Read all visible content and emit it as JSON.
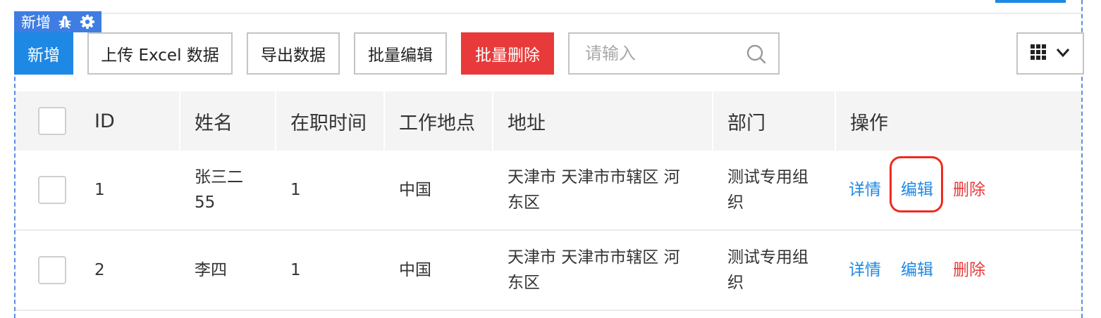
{
  "designer_tag": {
    "label": "新增",
    "icons": [
      "bug-icon",
      "gear-icon"
    ]
  },
  "toolbar": {
    "add_label": "新增",
    "upload_label": "上传 Excel 数据",
    "export_label": "导出数据",
    "batch_edit_label": "批量编辑",
    "batch_delete_label": "批量删除",
    "search_placeholder": "请输入",
    "column_toggle_icons": [
      "grid-icon",
      "chevron-down-icon"
    ]
  },
  "table": {
    "columns": [
      "ID",
      "姓名",
      "在职时间",
      "工作地点",
      "地址",
      "部门",
      "操作"
    ],
    "rows": [
      {
        "id": "1",
        "name_line1": "张三二",
        "name_line2": "55",
        "tenure": "1",
        "location": "中国",
        "address_line1": "天津市 天津市市辖区 河",
        "address_line2": "东区",
        "dept_line1": "测试专用组",
        "dept_line2": "织",
        "actions": {
          "detail": "详情",
          "edit": "编辑",
          "delete": "删除"
        }
      },
      {
        "id": "2",
        "name_line1": "李四",
        "name_line2": "",
        "tenure": "1",
        "location": "中国",
        "address_line1": "天津市 天津市市辖区 河",
        "address_line2": "东区",
        "dept_line1": "测试专用组",
        "dept_line2": "织",
        "actions": {
          "detail": "详情",
          "edit": "编辑",
          "delete": "删除"
        }
      }
    ]
  },
  "colors": {
    "primary": "#1e88e5",
    "danger": "#e83a3a",
    "designer_frame": "#3f7de3",
    "highlight": "#ee2c1f",
    "header_bg": "#f4f4f4"
  }
}
